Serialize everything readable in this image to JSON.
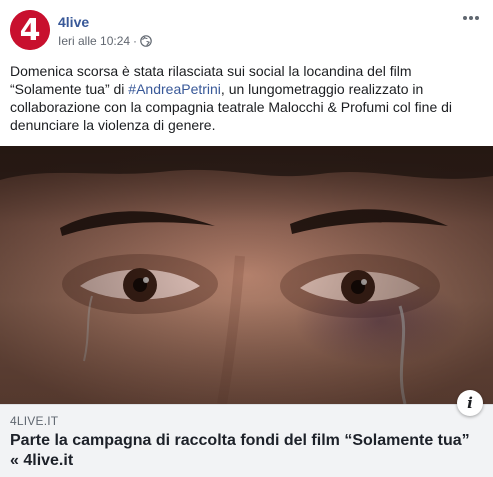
{
  "post": {
    "page_name": "4live",
    "avatar_text": "4",
    "timestamp": "Ieri alle 10:24",
    "separator": "·",
    "privacy_icon": "globe-icon",
    "more_icon": "ellipsis-icon",
    "text_part1": "Domenica scorsa è stata rilasciata sui social la locandina del film “Solamente tua” di ",
    "hashtag": "#AndreaPetrini",
    "text_part2": ", un lungometraggio realizzato in collaborazione con la compagnia teatrale Malocchi & Profumi col fine di denunciare la violenza di genere."
  },
  "link": {
    "domain": "4LIVE.IT",
    "title": "Parte la campagna di raccolta fondi del film “Solamente tua” « 4live.it",
    "info_label": "i"
  },
  "colors": {
    "brand_red": "#c8102e",
    "link_blue": "#385898",
    "card_bg": "#f2f3f5"
  }
}
